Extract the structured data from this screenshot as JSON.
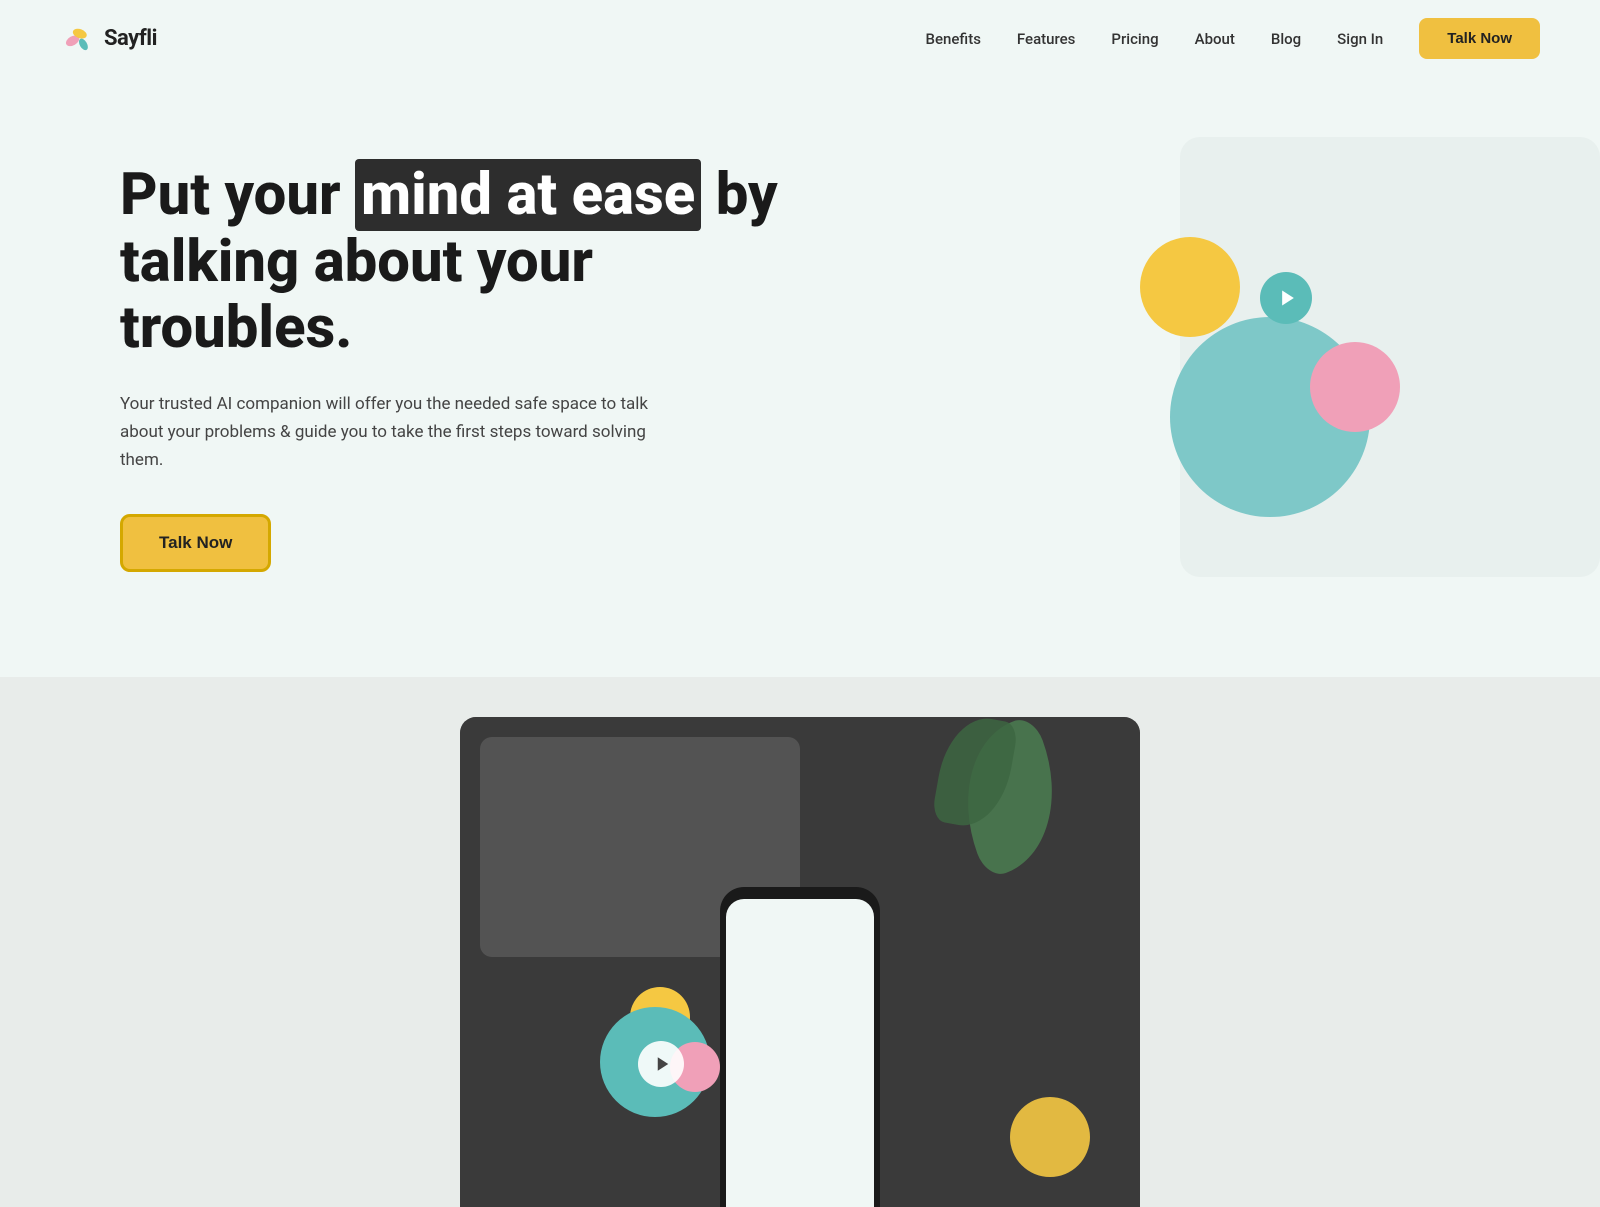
{
  "brand": {
    "logo_text": "Sayfli",
    "logo_icon_alt": "Sayfli logo icon"
  },
  "nav": {
    "links": [
      {
        "id": "benefits",
        "label": "Benefits"
      },
      {
        "id": "features",
        "label": "Features"
      },
      {
        "id": "pricing",
        "label": "Pricing"
      },
      {
        "id": "about",
        "label": "About"
      },
      {
        "id": "blog",
        "label": "Blog"
      },
      {
        "id": "signin",
        "label": "Sign In"
      }
    ],
    "cta_label": "Talk Now"
  },
  "hero": {
    "title_prefix": "Put your ",
    "title_highlight": "mind at ease",
    "title_suffix": " by talking about your troubles.",
    "subtitle": "Your trusted AI companion will offer you the needed safe space to talk about your problems & guide you to take the first steps toward solving them.",
    "cta_label": "Talk Now"
  },
  "hero_illustration": {
    "play_icon": "▶"
  },
  "phone_section": {
    "play_icon": "▶"
  },
  "colors": {
    "yellow": "#f5c842",
    "teal": "#5bbcb8",
    "pink": "#f0a0b8",
    "blue_circle": "#7ec8c8",
    "bg": "#f0f7f5",
    "nav_cta_bg": "#f0c040",
    "hero_cta_bg": "#f0c040",
    "hero_cta_border": "#d4a800",
    "highlight_bg": "#2d2d2d"
  }
}
